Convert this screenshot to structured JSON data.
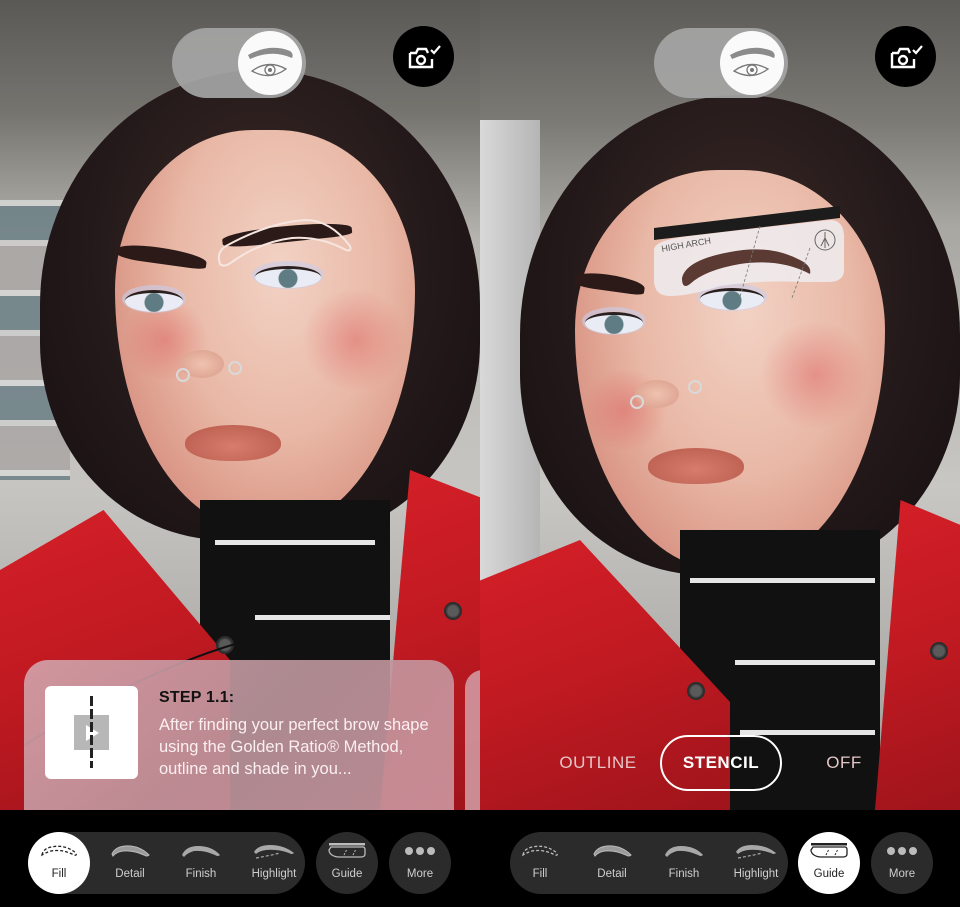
{
  "left_screen": {
    "toggle": {
      "state": "on",
      "icon": "brow-eye-icon"
    },
    "camera_button": {
      "icon": "camera-check-icon"
    },
    "overlay": "brow-outline",
    "tutorial_card": {
      "title": "STEP 1.1:",
      "body": "After finding your perfect brow shape using the Golden Ratio® Method, outline and shade in you...",
      "thumbnail_icon": "play-icon"
    },
    "toolbar": {
      "active": "Fill",
      "items": [
        {
          "label": "Fill",
          "icon": "dashed-brow-icon"
        },
        {
          "label": "Detail",
          "icon": "hatched-brow-icon"
        },
        {
          "label": "Finish",
          "icon": "solid-brow-icon"
        },
        {
          "label": "Highlight",
          "icon": "highlight-brow-icon"
        },
        {
          "label": "Guide",
          "icon": "stencil-icon"
        },
        {
          "label": "More",
          "icon": "more-dots-icon"
        }
      ]
    }
  },
  "right_screen": {
    "toggle": {
      "state": "on",
      "icon": "brow-eye-icon"
    },
    "camera_button": {
      "icon": "camera-check-icon"
    },
    "overlay": "brow-stencil",
    "stencil_label": "HIGH ARCH",
    "modes": {
      "active": "STENCIL",
      "items": [
        "OUTLINE",
        "STENCIL",
        "OFF"
      ]
    },
    "toolbar": {
      "active": "Guide",
      "items": [
        {
          "label": "Fill",
          "icon": "dashed-brow-icon"
        },
        {
          "label": "Detail",
          "icon": "hatched-brow-icon"
        },
        {
          "label": "Finish",
          "icon": "solid-brow-icon"
        },
        {
          "label": "Highlight",
          "icon": "highlight-brow-icon"
        },
        {
          "label": "Guide",
          "icon": "stencil-icon"
        },
        {
          "label": "More",
          "icon": "more-dots-icon"
        }
      ]
    }
  },
  "colors": {
    "toolbar_bg": "#000000",
    "pill_bg": "#2b2b2b",
    "active_tool_bg": "#ffffff",
    "card_bg": "#d2a0a8",
    "jacket_red": "#c21a22"
  }
}
